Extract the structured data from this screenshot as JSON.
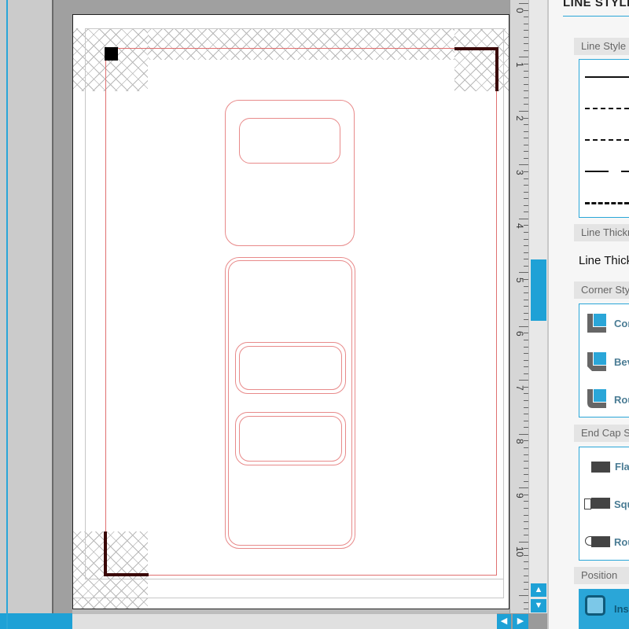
{
  "panel": {
    "title": "LINE STYLE",
    "sections": {
      "line_style": "Line Style",
      "line_thickness": "Line Thickness",
      "corner_style": "Corner Style",
      "end_cap_style": "End Cap Style",
      "position": "Position"
    },
    "line_thickness_label": "Line Thickness",
    "corner_options": [
      "Corner",
      "Bevel",
      "Round"
    ],
    "end_cap_options": [
      "Flat",
      "Square",
      "Round"
    ],
    "position_option": "Inside"
  },
  "ruler": {
    "numbers": [
      "0",
      "1",
      "2",
      "3",
      "4",
      "5",
      "6",
      "7",
      "8",
      "9",
      "10"
    ]
  },
  "nav": {
    "up": "▲",
    "down": "▼",
    "left": "◀",
    "right": "▶"
  },
  "colors": {
    "accent": "#1ea1d6",
    "cut_line": "#e88a8a"
  }
}
